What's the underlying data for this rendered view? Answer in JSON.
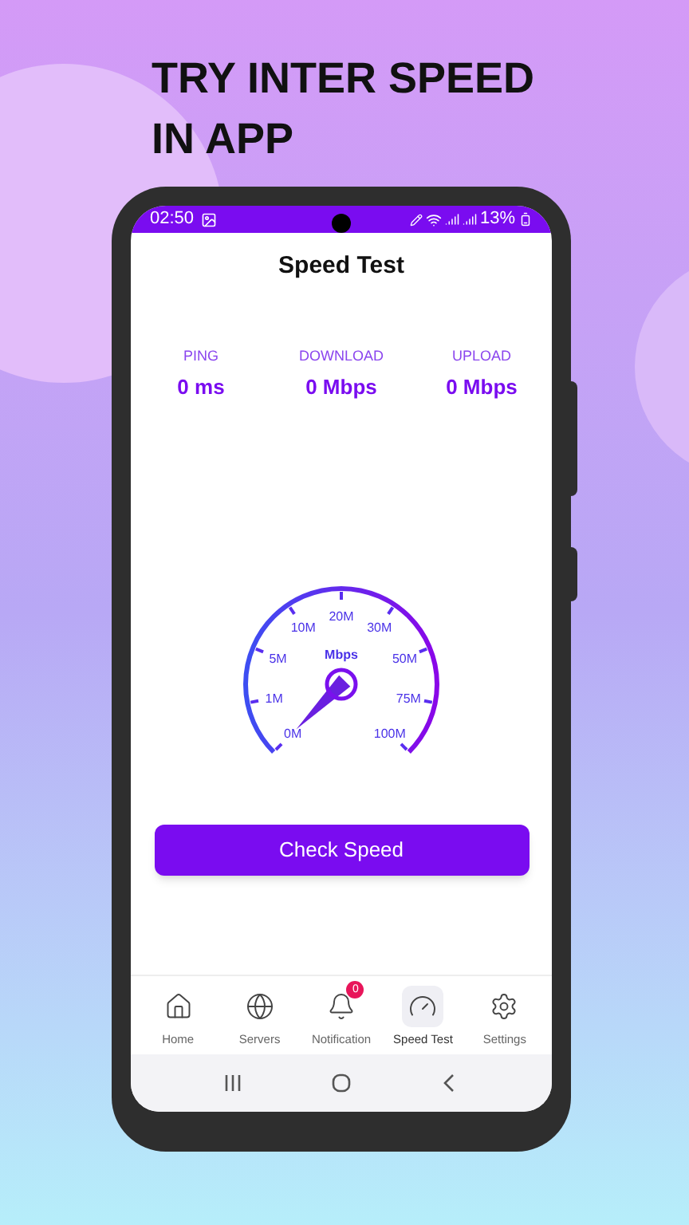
{
  "headline": "TRY INTER SPEED IN APP",
  "status_bar": {
    "time": "02:50",
    "battery": "13%"
  },
  "screen": {
    "title": "Speed Test"
  },
  "stats": [
    {
      "label": "PING",
      "value": "0 ms"
    },
    {
      "label": "DOWNLOAD",
      "value": "0 Mbps"
    },
    {
      "label": "UPLOAD",
      "value": "0 Mbps"
    }
  ],
  "gauge": {
    "unit": "Mbps",
    "labels": [
      "0M",
      "1M",
      "5M",
      "10M",
      "20M",
      "30M",
      "50M",
      "75M",
      "100M"
    ]
  },
  "button": "Check Speed",
  "nav": [
    {
      "kind": "home",
      "label": "Home",
      "selected": false
    },
    {
      "kind": "globe",
      "label": "Servers",
      "selected": false
    },
    {
      "kind": "bell",
      "label": "Notification",
      "selected": false,
      "badge": "0"
    },
    {
      "kind": "gauge",
      "label": "Speed Test",
      "selected": true
    },
    {
      "kind": "settings",
      "label": "Settings",
      "selected": false
    }
  ]
}
